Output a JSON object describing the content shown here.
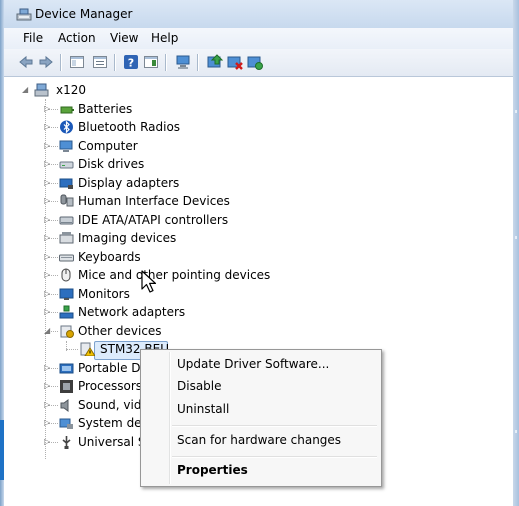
{
  "window": {
    "title": "Device Manager"
  },
  "menu": [
    "File",
    "Action",
    "View",
    "Help"
  ],
  "toolbar": {
    "buttons": [
      "back-icon",
      "forward-icon",
      "show-hide-console-tree-icon",
      "properties-icon",
      "help-icon",
      "action-pane-icon",
      "computer-icon",
      "update-driver-icon",
      "disable-device-icon",
      "uninstall-device-icon"
    ]
  },
  "tree": {
    "root": "x120",
    "categories": [
      "Batteries",
      "Bluetooth Radios",
      "Computer",
      "Disk drives",
      "Display adapters",
      "Human Interface Devices",
      "IDE ATA/ATAPI controllers",
      "Imaging devices",
      "Keyboards",
      "Mice and other pointing devices",
      "Monitors",
      "Network adapters",
      "Other devices"
    ],
    "selected_device": "STM32 BEU",
    "categories_after": [
      "Portable De",
      "Processors",
      "Sound, vide",
      "System dev",
      "Universal Se"
    ]
  },
  "context_menu": {
    "update_driver": "Update Driver Software...",
    "disable": "Disable",
    "uninstall": "Uninstall",
    "scan": "Scan for hardware changes",
    "properties": "Properties"
  }
}
